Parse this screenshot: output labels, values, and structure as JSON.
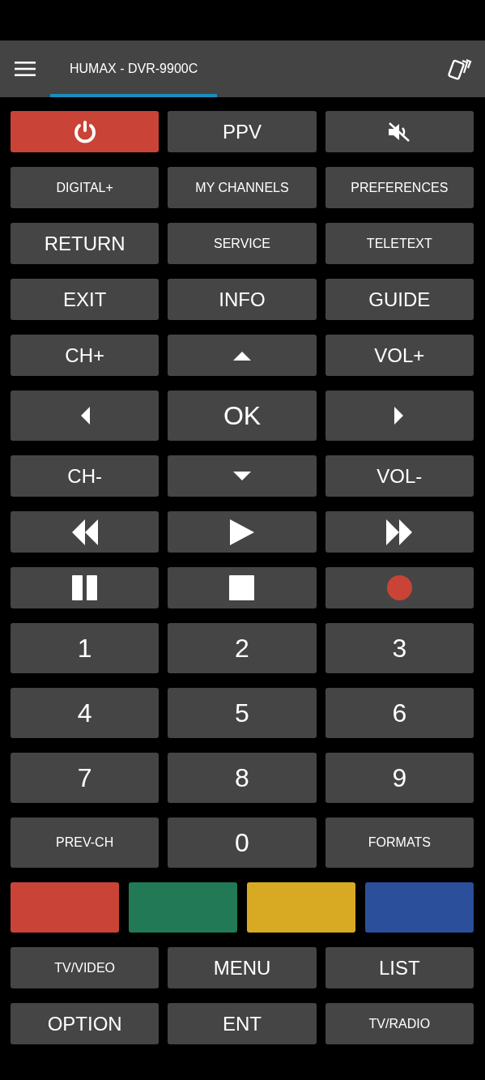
{
  "header": {
    "tabs": [
      {
        "label": "HUMAX - DVR-9900C",
        "selected": true
      }
    ]
  },
  "rows": [
    [
      {
        "kind": "power"
      },
      {
        "kind": "text",
        "label": "PPV"
      },
      {
        "kind": "mute"
      }
    ],
    [
      {
        "kind": "text",
        "label": "DIGITAL+"
      },
      {
        "kind": "text",
        "label": "MY CHANNELS"
      },
      {
        "kind": "text",
        "label": "PREFERENCES"
      }
    ],
    [
      {
        "kind": "text",
        "label": "RETURN"
      },
      {
        "kind": "text",
        "label": "SERVICE"
      },
      {
        "kind": "text",
        "label": "TELETEXT"
      }
    ],
    [
      {
        "kind": "text",
        "label": "EXIT"
      },
      {
        "kind": "text",
        "label": "INFO"
      },
      {
        "kind": "text",
        "label": "GUIDE"
      }
    ],
    [
      {
        "kind": "text",
        "label": "CH+"
      },
      {
        "kind": "up"
      },
      {
        "kind": "text",
        "label": "VOL+"
      }
    ],
    [
      {
        "kind": "left"
      },
      {
        "kind": "text",
        "label": "OK"
      },
      {
        "kind": "right"
      }
    ],
    [
      {
        "kind": "text",
        "label": "CH-"
      },
      {
        "kind": "down"
      },
      {
        "kind": "text",
        "label": "VOL-"
      }
    ],
    [
      {
        "kind": "rewind"
      },
      {
        "kind": "play"
      },
      {
        "kind": "forward"
      }
    ],
    [
      {
        "kind": "pause"
      },
      {
        "kind": "stop"
      },
      {
        "kind": "record"
      }
    ],
    [
      {
        "kind": "text",
        "label": "1"
      },
      {
        "kind": "text",
        "label": "2"
      },
      {
        "kind": "text",
        "label": "3"
      }
    ],
    [
      {
        "kind": "text",
        "label": "4"
      },
      {
        "kind": "text",
        "label": "5"
      },
      {
        "kind": "text",
        "label": "6"
      }
    ],
    [
      {
        "kind": "text",
        "label": "7"
      },
      {
        "kind": "text",
        "label": "8"
      },
      {
        "kind": "text",
        "label": "9"
      }
    ],
    [
      {
        "kind": "text",
        "label": "PREV-CH"
      },
      {
        "kind": "text",
        "label": "0"
      },
      {
        "kind": "text",
        "label": "FORMATS"
      }
    ],
    [
      {
        "kind": "color",
        "color": "#c94436"
      },
      {
        "kind": "color",
        "color": "#217a55"
      },
      {
        "kind": "color",
        "color": "#d8aa24"
      },
      {
        "kind": "color",
        "color": "#2b4f9a"
      }
    ],
    [
      {
        "kind": "text",
        "label": "TV/VIDEO"
      },
      {
        "kind": "text",
        "label": "MENU"
      },
      {
        "kind": "text",
        "label": "LIST"
      }
    ],
    [
      {
        "kind": "text",
        "label": "OPTION"
      },
      {
        "kind": "text",
        "label": "ENT"
      },
      {
        "kind": "text",
        "label": "TV/RADIO"
      }
    ]
  ]
}
